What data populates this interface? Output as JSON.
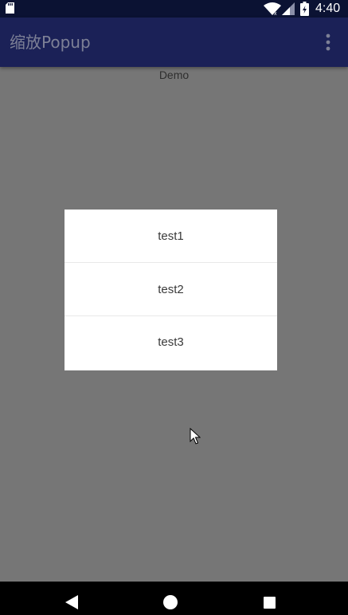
{
  "status_bar": {
    "time": "4:40",
    "icons": [
      "sd-card-icon",
      "wifi-icon",
      "signal-icon",
      "battery-icon"
    ]
  },
  "app_bar": {
    "title": "缩放Popup",
    "overflow_icon": "more-vert-icon"
  },
  "content": {
    "demo_label": "Demo"
  },
  "popup": {
    "items": [
      {
        "label": "test1"
      },
      {
        "label": "test2"
      },
      {
        "label": "test3"
      }
    ]
  },
  "nav_bar": {
    "buttons": [
      "back-icon",
      "home-icon",
      "recents-icon"
    ]
  },
  "colors": {
    "status_bar": "#0b1233",
    "app_bar": "#1b2157",
    "scrim_background": "#767676",
    "popup_background": "#ffffff",
    "nav_bar": "#000000"
  }
}
